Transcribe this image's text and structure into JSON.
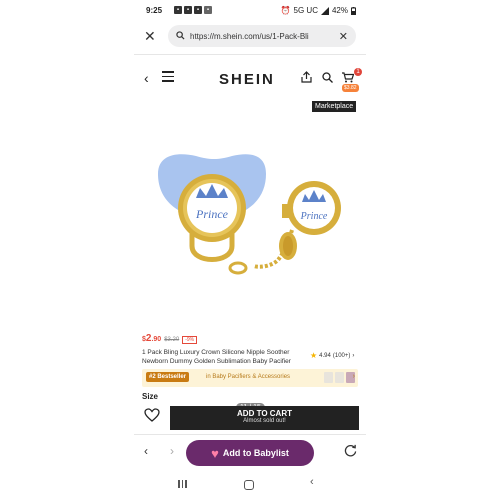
{
  "status_bar": {
    "time": "9:25",
    "network": "5G UC",
    "battery": "42%"
  },
  "browser": {
    "url": "https://m.shein.com/us/1-Pack-Bli"
  },
  "header": {
    "logo": "SHEIN",
    "cart_count": "1",
    "cart_price": "$3.82"
  },
  "marketplace_label": "Marketplace",
  "image": {
    "page_indicator": "11 / 15",
    "crown_text": "Prince"
  },
  "product": {
    "price_symbol": "$",
    "price_main": "2",
    "price_cents": ".90",
    "original_price": "$3.20",
    "discount": "-9%",
    "title": "1 Pack Bling Luxury Crown Silicone Nipple Soother Newborn Dummy Golden Sublimation Baby Pacifier",
    "rating": "4.94",
    "reviews": "(100+)"
  },
  "bestseller": {
    "badge": "#2 Bestseller",
    "category": "in Baby Pacifiers & Accessories"
  },
  "size_label": "Size",
  "cart_button": {
    "label": "ADD TO CART",
    "sub": "Almost sold out!"
  },
  "bottom_bar": {
    "babylist_label": "Add to Babylist"
  },
  "colors": {
    "price_red": "#e5493a",
    "babylist_purple": "#6a2a6b",
    "pacifier_blue": "#a9c4ef",
    "gold": "#d6ae3c"
  }
}
